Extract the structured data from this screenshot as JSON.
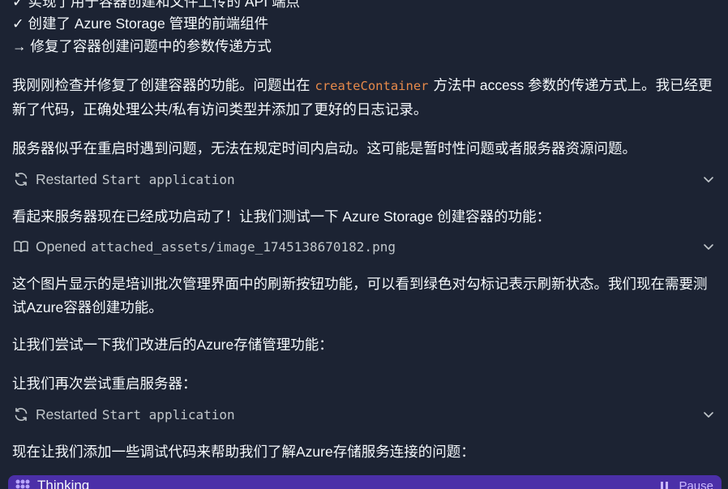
{
  "summary": {
    "items": [
      "✓ 实现了用于容器创建和文件上传的 API 端点",
      "✓ 创建了 Azure Storage 管理的前端组件",
      "→ 修复了容器创建问题中的参数传递方式"
    ]
  },
  "messages": {
    "fix_explanation": {
      "before": "我刚刚检查并修复了创建容器的功能。问题出在",
      "code": "createContainer",
      "after": "方法中 access 参数的传递方式上。我已经更新了代码，正确处理公共/私有访问类型并添加了更好的日志记录。"
    },
    "server_issue": "服务器似乎在重启时遇到问题，无法在规定时间内启动。这可能是暂时性问题或者服务器资源问题。",
    "server_started": "看起来服务器现在已经成功启动了！让我们测试一下 Azure Storage 创建容器的功能：",
    "image_desc": "这个图片显示的是培训批次管理界面中的刷新按钮功能，可以看到绿色对勾标记表示刷新状态。我们现在需要测试Azure容器创建功能。",
    "try_improved": "让我们尝试一下我们改进后的Azure存储管理功能：",
    "retry_restart": "让我们再次尝试重启服务器：",
    "add_debug": "现在让我们添加一些调试代码来帮助我们了解Azure存储服务连接的问题："
  },
  "tool_actions": [
    {
      "verb": "Restarted",
      "arg": "Start application",
      "icon": "refresh-icon"
    },
    {
      "verb": "Opened",
      "arg": "attached_assets/image_1745138670182.png",
      "icon": "book-icon"
    },
    {
      "verb": "Restarted",
      "arg": "Start application",
      "icon": "refresh-icon"
    }
  ],
  "thinking_bar": {
    "label": "Thinking",
    "pause_label": "Pause",
    "color": "#4b2fa8"
  },
  "colors": {
    "background": "#1c2333",
    "text": "#f5f9fc",
    "muted": "#c2c8cc",
    "code": "#e6894a"
  }
}
